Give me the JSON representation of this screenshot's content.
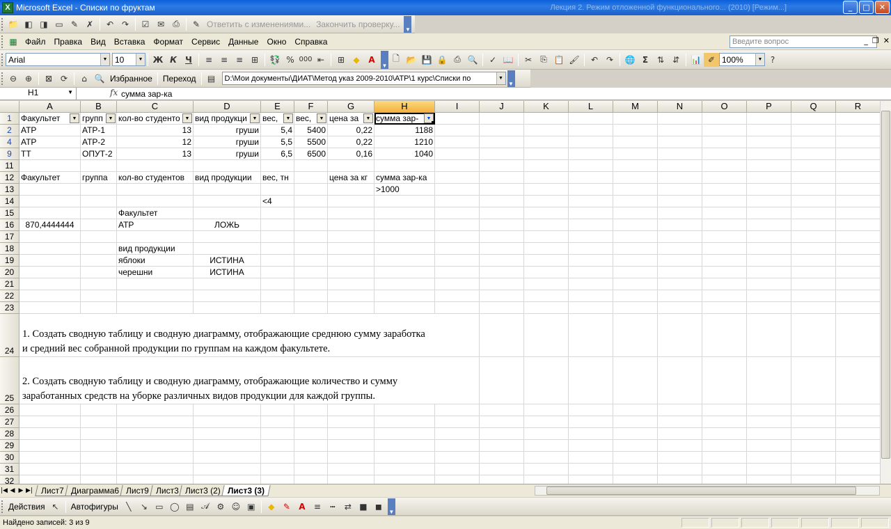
{
  "window": {
    "app_letter": "X",
    "title": "Microsoft Excel - Списки по фруктам",
    "ghost_text": "Лекция 2. Режим отложенной функционального... (2010) [Режим...]",
    "min": "_",
    "max": "□",
    "close": "✕"
  },
  "reviewing_toolbar": {
    "reply": "Ответить с изменениями...",
    "end_review": "Закончить проверку..."
  },
  "menu": {
    "items": [
      "Файл",
      "Правка",
      "Вид",
      "Вставка",
      "Формат",
      "Сервис",
      "Данные",
      "Окно",
      "Справка"
    ],
    "ask_placeholder": "Введите вопрос"
  },
  "format_toolbar": {
    "font": "Arial",
    "size": "10",
    "bold": "Ж",
    "italic": "К",
    "underline": "Ч",
    "percent": "%",
    "thousands": "000",
    "zoom": "100%"
  },
  "web_toolbar": {
    "favorites": "Избранное",
    "go": "Переход",
    "address": "D:\\Мои документы\\ДИАТ\\Метод указ 2009-2010\\АТР\\1 курс\\Списки по"
  },
  "formula_bar": {
    "cell_ref": "H1",
    "fx": "fx",
    "content": "сумма зар-ка"
  },
  "columns": [
    "A",
    "B",
    "C",
    "D",
    "E",
    "F",
    "G",
    "H",
    "I",
    "J",
    "K",
    "L",
    "M",
    "N",
    "O",
    "P",
    "Q",
    "R"
  ],
  "selected_col": "H",
  "rows": [
    {
      "n": "1",
      "blue": true,
      "cells": [
        "Факультет",
        "групп",
        "кол-во студенто",
        "вид продукци",
        "вес,",
        "вес,",
        "цена за",
        "сумма зар-",
        "",
        "",
        "",
        "",
        "",
        "",
        "",
        "",
        "",
        ""
      ]
    },
    {
      "n": "2",
      "blue": true,
      "cells": [
        "АТР",
        "АТР-1",
        "13",
        "груши",
        "5,4",
        "5400",
        "0,22",
        "1188",
        "",
        "",
        "",
        "",
        "",
        "",
        "",
        "",
        "",
        ""
      ]
    },
    {
      "n": "4",
      "blue": true,
      "cells": [
        "АТР",
        "АТР-2",
        "12",
        "груши",
        "5,5",
        "5500",
        "0,22",
        "1210",
        "",
        "",
        "",
        "",
        "",
        "",
        "",
        "",
        "",
        ""
      ]
    },
    {
      "n": "9",
      "blue": true,
      "cells": [
        "ТТ",
        "ОПУТ-2",
        "13",
        "груши",
        "6,5",
        "6500",
        "0,16",
        "1040",
        "",
        "",
        "",
        "",
        "",
        "",
        "",
        "",
        "",
        ""
      ]
    },
    {
      "n": "11",
      "cells": [
        "",
        "",
        "",
        "",
        "",
        "",
        "",
        "",
        "",
        "",
        "",
        "",
        "",
        "",
        "",
        "",
        "",
        ""
      ]
    },
    {
      "n": "12",
      "cells": [
        "Факультет",
        "группа",
        "кол-во студентов",
        "вид продукции",
        "вес, тн",
        "",
        "цена за кг",
        "сумма зар-ка",
        "",
        "",
        "",
        "",
        "",
        "",
        "",
        "",
        "",
        ""
      ]
    },
    {
      "n": "13",
      "cells": [
        "",
        "",
        "",
        "",
        "",
        "",
        "",
        ">1000",
        "",
        "",
        "",
        "",
        "",
        "",
        "",
        "",
        "",
        ""
      ]
    },
    {
      "n": "14",
      "cells": [
        "",
        "",
        "",
        "",
        "<4",
        "",
        "",
        "",
        "",
        "",
        "",
        "",
        "",
        "",
        "",
        "",
        "",
        ""
      ]
    },
    {
      "n": "15",
      "cells": [
        "",
        "",
        "Факультет",
        "",
        "",
        "",
        "",
        "",
        "",
        "",
        "",
        "",
        "",
        "",
        "",
        "",
        "",
        ""
      ]
    },
    {
      "n": "16",
      "cells": [
        "870,4444444",
        "",
        "АТР",
        "ЛОЖЬ",
        "",
        "",
        "",
        "",
        "",
        "",
        "",
        "",
        "",
        "",
        "",
        "",
        "",
        ""
      ]
    },
    {
      "n": "17",
      "cells": [
        "",
        "",
        "",
        "",
        "",
        "",
        "",
        "",
        "",
        "",
        "",
        "",
        "",
        "",
        "",
        "",
        "",
        ""
      ]
    },
    {
      "n": "18",
      "cells": [
        "",
        "",
        "вид продукции",
        "",
        "",
        "",
        "",
        "",
        "",
        "",
        "",
        "",
        "",
        "",
        "",
        "",
        "",
        ""
      ]
    },
    {
      "n": "19",
      "cells": [
        "",
        "",
        "яблоки",
        "ИСТИНА",
        "",
        "",
        "",
        "",
        "",
        "",
        "",
        "",
        "",
        "",
        "",
        "",
        "",
        ""
      ]
    },
    {
      "n": "20",
      "cells": [
        "",
        "",
        "черешни",
        "ИСТИНА",
        "",
        "",
        "",
        "",
        "",
        "",
        "",
        "",
        "",
        "",
        "",
        "",
        "",
        ""
      ]
    },
    {
      "n": "21",
      "cells": [
        "",
        "",
        "",
        "",
        "",
        "",
        "",
        "",
        "",
        "",
        "",
        "",
        "",
        "",
        "",
        "",
        "",
        ""
      ]
    },
    {
      "n": "22",
      "cells": [
        "",
        "",
        "",
        "",
        "",
        "",
        "",
        "",
        "",
        "",
        "",
        "",
        "",
        "",
        "",
        "",
        "",
        ""
      ]
    },
    {
      "n": "23",
      "cells": [
        "",
        "",
        "",
        "",
        "",
        "",
        "",
        "",
        "",
        "",
        "",
        "",
        "",
        "",
        "",
        "",
        "",
        ""
      ]
    },
    {
      "n": "24",
      "cells": [
        "",
        "",
        "",
        "",
        "",
        "",
        "",
        "",
        "",
        "",
        "",
        "",
        "",
        "",
        "",
        "",
        "",
        ""
      ]
    },
    {
      "n": "25",
      "cells": [
        "",
        "",
        "",
        "",
        "",
        "",
        "",
        "",
        "",
        "",
        "",
        "",
        "",
        "",
        "",
        "",
        "",
        ""
      ]
    },
    {
      "n": "26",
      "cells": [
        "",
        "",
        "",
        "",
        "",
        "",
        "",
        "",
        "",
        "",
        "",
        "",
        "",
        "",
        "",
        "",
        "",
        ""
      ]
    },
    {
      "n": "27",
      "cells": [
        "",
        "",
        "",
        "",
        "",
        "",
        "",
        "",
        "",
        "",
        "",
        "",
        "",
        "",
        "",
        "",
        "",
        ""
      ]
    },
    {
      "n": "28",
      "cells": [
        "",
        "",
        "",
        "",
        "",
        "",
        "",
        "",
        "",
        "",
        "",
        "",
        "",
        "",
        "",
        "",
        "",
        ""
      ]
    },
    {
      "n": "29",
      "cells": [
        "",
        "",
        "",
        "",
        "",
        "",
        "",
        "",
        "",
        "",
        "",
        "",
        "",
        "",
        "",
        "",
        "",
        ""
      ]
    },
    {
      "n": "30",
      "cells": [
        "",
        "",
        "",
        "",
        "",
        "",
        "",
        "",
        "",
        "",
        "",
        "",
        "",
        "",
        "",
        "",
        "",
        ""
      ]
    },
    {
      "n": "31",
      "cells": [
        "",
        "",
        "",
        "",
        "",
        "",
        "",
        "",
        "",
        "",
        "",
        "",
        "",
        "",
        "",
        "",
        "",
        ""
      ]
    },
    {
      "n": "32",
      "cells": [
        "",
        "",
        "",
        "",
        "",
        "",
        "",
        "",
        "",
        "",
        "",
        "",
        "",
        "",
        "",
        "",
        "",
        ""
      ]
    }
  ],
  "tasks": {
    "t24": "1.      Создать сводную таблицу и сводную диаграмму, отображающие среднюю сумму заработка и средний вес собранной продукции по группам на каждом факультете.",
    "t25": "2.      Создать сводную таблицу и сводную диаграмму, отображающие количество и сумму заработанных средств на уборке различных видов продукции для каждой группы."
  },
  "sheet_tabs": [
    "Лист7",
    "Диаграмма6",
    "Лист9",
    "Лист3",
    "Лист3 (2)",
    "Лист3 (3)"
  ],
  "active_sheet": "Лист3 (3)",
  "draw_toolbar": {
    "actions": "Действия",
    "autoshapes": "Автофигуры"
  },
  "status": {
    "text": "Найдено записей: 3 из 9"
  }
}
